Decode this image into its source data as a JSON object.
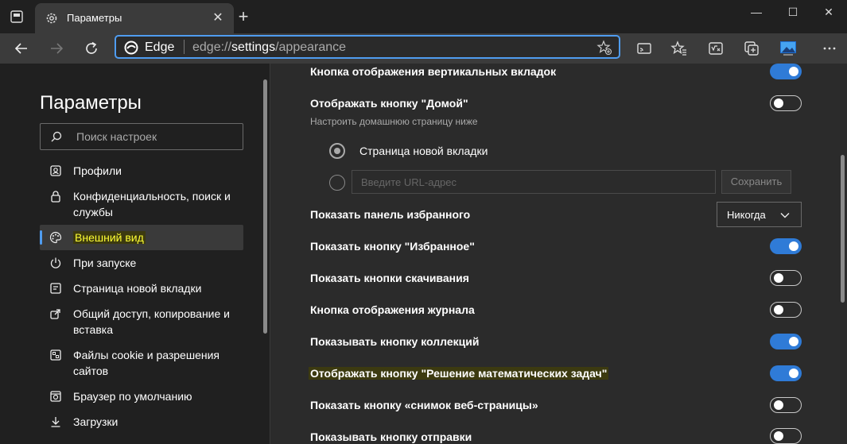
{
  "window": {
    "tab_title": "Параметры",
    "new_tab_symbol": "+",
    "close_tab_symbol": "✕",
    "minimize_symbol": "—",
    "maximize_symbol": "☐",
    "close_symbol": "✕"
  },
  "toolbar": {
    "brand": "Edge",
    "url_scheme": "edge://",
    "url_host": "settings",
    "url_path": "/appearance"
  },
  "sidebar": {
    "title": "Параметры",
    "search_placeholder": "Поиск настроек",
    "items": [
      {
        "label": "Профили",
        "icon": "profile-icon"
      },
      {
        "label": "Конфиденциальность, поиск и службы",
        "icon": "lock-icon"
      },
      {
        "label": "Внешний вид",
        "icon": "palette-icon",
        "active": true
      },
      {
        "label": "При запуске",
        "icon": "power-icon"
      },
      {
        "label": "Страница новой вкладки",
        "icon": "newtab-page-icon"
      },
      {
        "label": "Общий доступ, копирование и вставка",
        "icon": "share-icon"
      },
      {
        "label": "Файлы cookie и разрешения сайтов",
        "icon": "cookie-icon"
      },
      {
        "label": "Браузер по умолчанию",
        "icon": "browser-icon"
      },
      {
        "label": "Загрузки",
        "icon": "download-icon"
      }
    ]
  },
  "main": {
    "vertical_tabs_label": "Кнопка отображения вертикальных вкладок",
    "home_button_label": "Отображать кнопку \"Домой\"",
    "home_button_sub": "Настроить домашнюю страницу ниже",
    "radio_newtab_label": "Страница новой вкладки",
    "url_placeholder": "Введите URL-адрес",
    "save_label": "Сохранить",
    "favorites_bar_label": "Показать панель избранного",
    "favorites_bar_value": "Никогда",
    "favorites_button_label": "Показать кнопку \"Избранное\"",
    "downloads_button_label": "Показать кнопки скачивания",
    "history_button_label": "Кнопка отображения журнала",
    "collections_button_label": "Показывать кнопку коллекций",
    "math_solver_label": "Отображать кнопку \"Решение математических задач\"",
    "web_capture_label": "Показать кнопку «снимок веб-страницы»",
    "share_button_label": "Показывать кнопку отправки"
  },
  "toggles": {
    "vertical_tabs": true,
    "home_button": false,
    "favorites_button": true,
    "downloads_button": false,
    "history_button": false,
    "collections_button": true,
    "math_solver": true,
    "web_capture": false,
    "share_button": false
  },
  "colors": {
    "accent": "#2f7bd7",
    "highlight_text": "#ffff33",
    "sidebar_bg": "#202020",
    "content_bg": "#2b2b2b"
  }
}
